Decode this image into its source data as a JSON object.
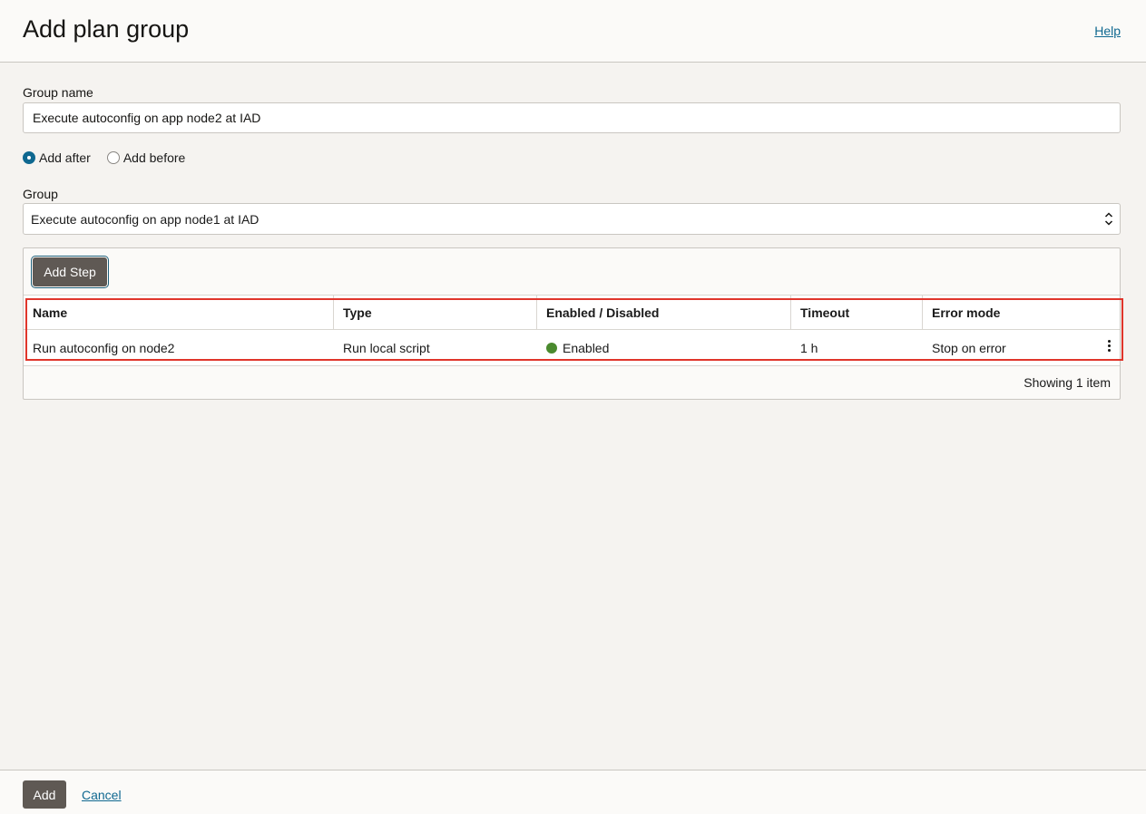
{
  "header": {
    "title": "Add plan group",
    "help": "Help"
  },
  "form": {
    "group_name_label": "Group name",
    "group_name_value": "Execute autoconfig on app node2 at IAD",
    "position_options": [
      {
        "label": "Add after",
        "checked": true
      },
      {
        "label": "Add before",
        "checked": false
      }
    ],
    "group_label": "Group",
    "group_selected": "Execute autoconfig on app node1 at IAD"
  },
  "steps": {
    "add_step_label": "Add Step",
    "columns": [
      "Name",
      "Type",
      "Enabled / Disabled",
      "Timeout",
      "Error mode"
    ],
    "rows": [
      {
        "name": "Run autoconfig on node2",
        "type": "Run local script",
        "status": "Enabled",
        "status_color": "#4a8a2e",
        "timeout": "1 h",
        "error_mode": "Stop on error"
      }
    ],
    "footer_text": "Showing 1 item"
  },
  "footer": {
    "add_label": "Add",
    "cancel_label": "Cancel"
  },
  "colors": {
    "primary_button": "#5f5954",
    "link": "#0f6890",
    "highlight": "#e0352b"
  },
  "icons": [
    "chevron-up-down-icon",
    "kebab-menu-icon",
    "radio-icon",
    "status-dot-icon"
  ]
}
